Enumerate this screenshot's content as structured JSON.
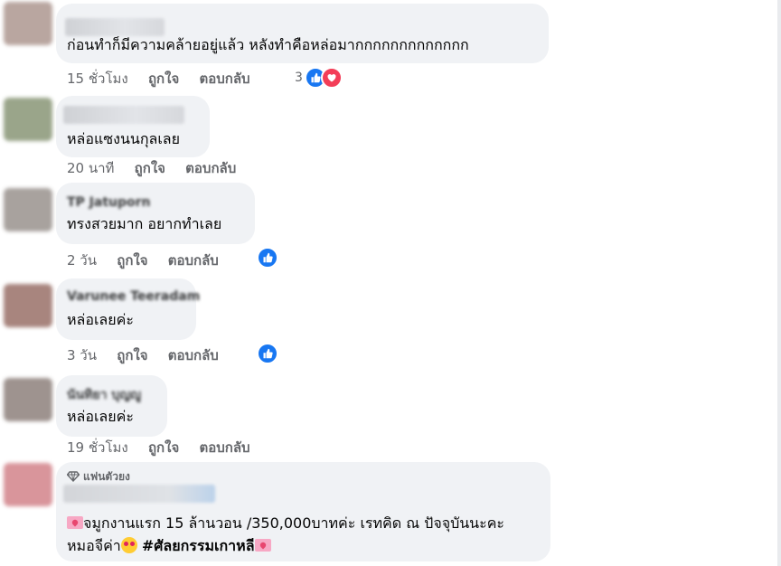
{
  "colors": {
    "bubble": "#f0f2f5",
    "meta_text": "#65676b",
    "like_blue": "#1877f2",
    "heart_red": "#f33e58"
  },
  "comments": [
    {
      "text": "ก่อนทำก็มีความคล้ายอยู่แล้ว หลังทำคือหล่อมากกกกกกกกกกกกก",
      "time": "15 ชั่วโมง",
      "like_label": "ถูกใจ",
      "reply_label": "ตอบกลับ",
      "reaction_count": "3",
      "reactions": [
        "like-icon",
        "heart-icon"
      ]
    },
    {
      "text": "หล่อแซงนนกุลเลย",
      "time": "20 นาที",
      "like_label": "ถูกใจ",
      "reply_label": "ตอบกลับ"
    },
    {
      "name": "TP Jatuporn",
      "text": "ทรงสวยมาก อยากทำเลย",
      "time": "2 วัน",
      "like_label": "ถูกใจ",
      "reply_label": "ตอบกลับ",
      "reactions": [
        "like-icon"
      ]
    },
    {
      "name": "Varunee Teeradam",
      "text": "หล่อเลยค่ะ",
      "time": "3 วัน",
      "like_label": "ถูกใจ",
      "reply_label": "ตอบกลับ",
      "reactions": [
        "like-icon"
      ]
    },
    {
      "name": "นันทิยา บุญญู",
      "text": "หล่อเลยค่ะ",
      "time": "19 ชั่วโมง",
      "like_label": "ถูกใจ",
      "reply_label": "ตอบกลับ"
    },
    {
      "badge": "แฟนตัวยง",
      "text_line1": "จมูกงานแรก 15 ล้านวอน /350,000บาทค่ะ เรทคิด ณ ปัจจุบันนะคะ",
      "text_line2_prefix": "หมอจีค่า",
      "hashtag": "#ศัลยกรรมเกาหลี"
    }
  ]
}
